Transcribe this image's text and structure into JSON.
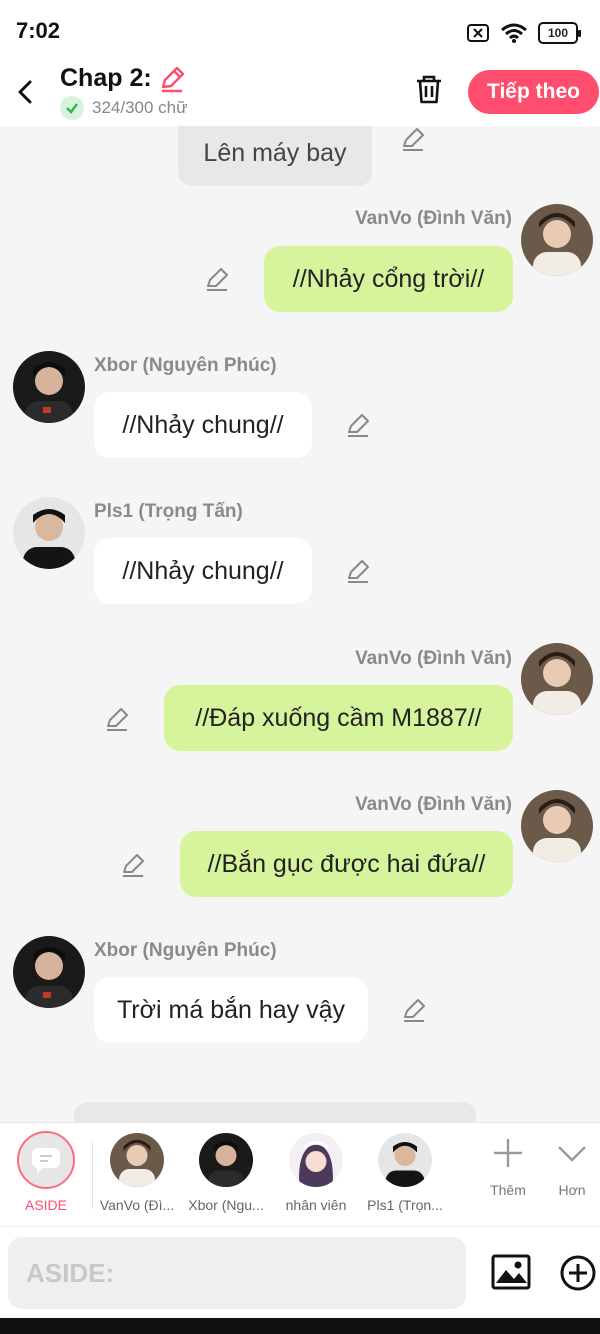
{
  "status_bar": {
    "time": "7:02",
    "battery": "100"
  },
  "header": {
    "title": "Chap 2:",
    "word_count": "324/300 chữ",
    "next_label": "Tiếp theo"
  },
  "messages": [
    {
      "type": "sys",
      "text": "Lên máy bay"
    },
    {
      "type": "me",
      "author": "VanVo (Đình Văn)",
      "text": "//Nhảy cổng trời//"
    },
    {
      "type": "other",
      "author": "Xbor (Nguyên Phúc)",
      "text": "//Nhảy chung//"
    },
    {
      "type": "other",
      "author": "Pls1 (Trọng Tấn)",
      "text": "//Nhảy chung//"
    },
    {
      "type": "me",
      "author": "VanVo (Đình Văn)",
      "text": "//Đáp xuống cầm M1887//"
    },
    {
      "type": "me",
      "author": "VanVo (Đình Văn)",
      "text": "//Bắn gục được hai đứa//"
    },
    {
      "type": "other",
      "author": "Xbor (Nguyên Phúc)",
      "text": "Trời má bắn hay vậy"
    }
  ],
  "characters": [
    {
      "label": "ASIDE"
    },
    {
      "label": "VanVo (Đì..."
    },
    {
      "label": "Xbor (Ngu..."
    },
    {
      "label": "nhân viên"
    },
    {
      "label": "Pls1 (Trọn..."
    }
  ],
  "tools": {
    "add_label": "Thêm",
    "more_label": "Hơn"
  },
  "input": {
    "placeholder": "ASIDE:"
  },
  "colors": {
    "accent": "#ff4d6d",
    "my_bubble": "#d6f49c",
    "other_bubble": "#ffffff"
  }
}
